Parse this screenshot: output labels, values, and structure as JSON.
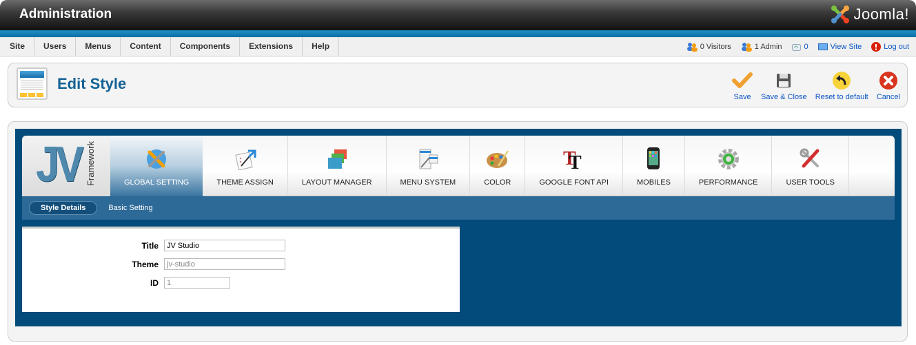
{
  "header": {
    "title": "Administration",
    "brand": "Joomla!"
  },
  "menu": {
    "items": [
      "Site",
      "Users",
      "Menus",
      "Content",
      "Components",
      "Extensions",
      "Help"
    ]
  },
  "status": {
    "visitors": "0 Visitors",
    "admins": "1 Admin",
    "messages": "0",
    "view_site": "View Site",
    "logout": "Log out"
  },
  "toolbar": {
    "page_title": "Edit Style",
    "buttons": [
      {
        "label": "Save",
        "icon": "checkmark-icon"
      },
      {
        "label": "Save & Close",
        "icon": "floppy-disk-icon"
      },
      {
        "label": "Reset to default",
        "icon": "reset-arrow-icon"
      },
      {
        "label": "Cancel",
        "icon": "cancel-x-icon"
      }
    ]
  },
  "framework": {
    "logo_text": "JV",
    "logo_sub": "Framework",
    "tabs": [
      {
        "label": "GLOBAL SETTING",
        "icon": "global-setting-icon",
        "active": true
      },
      {
        "label": "THEME ASSIGN",
        "icon": "theme-assign-icon"
      },
      {
        "label": "LAYOUT MANAGER",
        "icon": "layout-manager-icon"
      },
      {
        "label": "MENU SYSTEM",
        "icon": "menu-system-icon"
      },
      {
        "label": "COLOR",
        "icon": "palette-icon"
      },
      {
        "label": "GOOGLE FONT API",
        "icon": "font-icon"
      },
      {
        "label": "MOBILES",
        "icon": "mobile-phone-icon"
      },
      {
        "label": "PERFORMANCE",
        "icon": "gear-refresh-icon"
      },
      {
        "label": "USER TOOLS",
        "icon": "tools-icon"
      }
    ],
    "subtabs": [
      {
        "label": "Style Details",
        "active": true
      },
      {
        "label": "Basic Setting"
      }
    ]
  },
  "form": {
    "title_label": "Title",
    "title_value": "JV Studio",
    "theme_label": "Theme",
    "theme_value": "jv-studio",
    "id_label": "ID",
    "id_value": "1"
  },
  "colors": {
    "accent_blue": "#034b7b",
    "link": "#0b55c4",
    "heading": "#146295"
  }
}
